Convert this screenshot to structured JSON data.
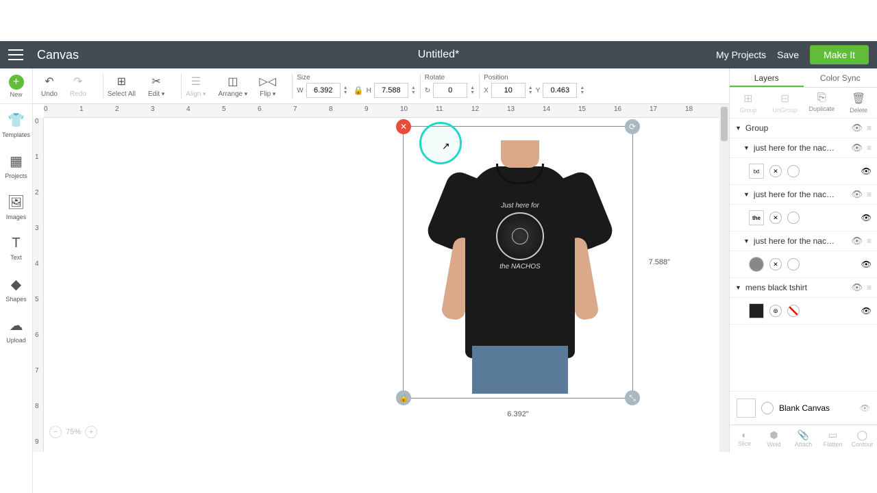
{
  "header": {
    "app_title": "Canvas",
    "doc_title": "Untitled*",
    "my_projects": "My Projects",
    "save": "Save",
    "make_it": "Make It"
  },
  "toolbar": {
    "undo": "Undo",
    "redo": "Redo",
    "select_all": "Select All",
    "edit": "Edit",
    "align": "Align",
    "arrange": "Arrange",
    "flip": "Flip",
    "size_label": "Size",
    "w": "W",
    "w_val": "6.392",
    "h": "H",
    "h_val": "7.588",
    "rotate_label": "Rotate",
    "rotate_val": "0",
    "position_label": "Position",
    "x": "X",
    "x_val": "10",
    "y": "Y",
    "y_val": "0.463"
  },
  "leftbar": {
    "new": "New",
    "templates": "Templates",
    "projects": "Projects",
    "images": "Images",
    "text": "Text",
    "shapes": "Shapes",
    "upload": "Upload"
  },
  "ruler_h": [
    "0",
    "1",
    "2",
    "3",
    "4",
    "5",
    "6",
    "7",
    "8",
    "9",
    "10",
    "11",
    "12",
    "13",
    "14",
    "15",
    "16",
    "17",
    "18"
  ],
  "ruler_v": [
    "0",
    "1",
    "2",
    "3",
    "4",
    "5",
    "6",
    "7",
    "8",
    "9"
  ],
  "selection": {
    "dim_w": "6.392\"",
    "dim_h": "7.588\"",
    "design_top": "Just here for",
    "design_bottom": "the NACHOS"
  },
  "zoom": {
    "value": "75%"
  },
  "rightpanel": {
    "tab_layers": "Layers",
    "tab_colorsync": "Color Sync",
    "act_group": "Group",
    "act_ungroup": "UnGroup",
    "act_duplicate": "Duplicate",
    "act_delete": "Delete",
    "layers": {
      "group": "Group",
      "item1": "just here for the nac…",
      "item2": "just here for the nac…",
      "item3": "just here for the nac…",
      "item4": "mens black tshirt",
      "blank_canvas": "Blank Canvas"
    },
    "foot": {
      "slice": "Slice",
      "weld": "Weld",
      "attach": "Attach",
      "flatten": "Flatten",
      "contour": "Contour"
    }
  }
}
